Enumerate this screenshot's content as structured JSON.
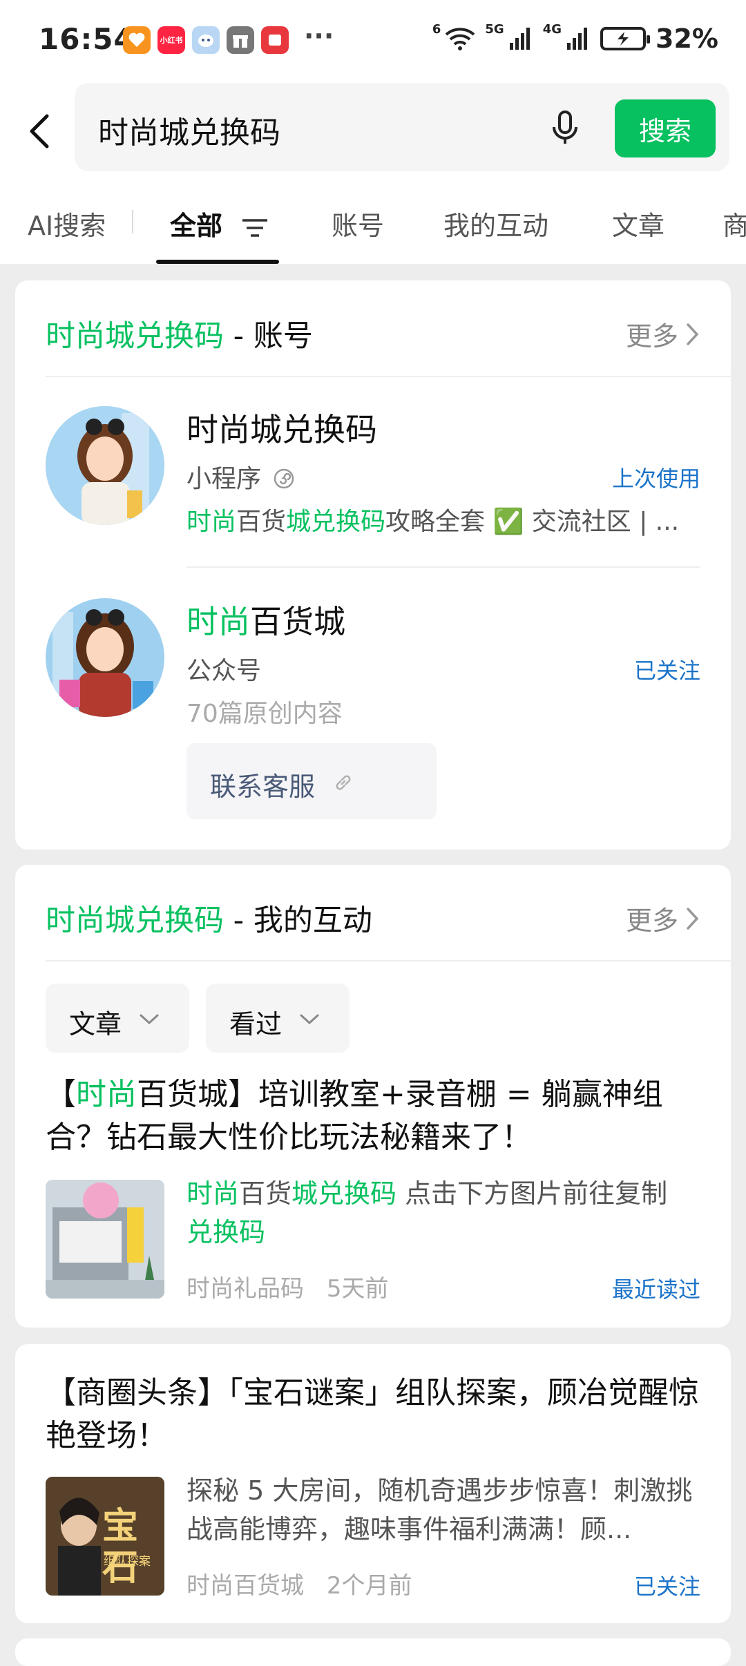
{
  "status_bar": {
    "time": "16:54",
    "battery": "32%",
    "network_5g": "5G",
    "network_4g": "4G",
    "wifi_badge": "6",
    "more_dots": "···",
    "app_xiaohongshu": "小红书"
  },
  "search": {
    "query": "时尚城兑换码",
    "button": "搜索"
  },
  "tabs": [
    {
      "label": "AI搜索"
    },
    {
      "label": "全部"
    },
    {
      "label": "账号"
    },
    {
      "label": "我的互动"
    },
    {
      "label": "文章"
    },
    {
      "label": "商"
    }
  ],
  "accounts_section": {
    "title_keyword": "时尚城兑换码",
    "title_suffix": " - 账号",
    "more": "更多",
    "items": [
      {
        "name": "时尚城兑换码",
        "type": "小程序",
        "desc_parts": [
          "时尚",
          "百货",
          "城兑换码",
          "攻略全套 ✅ 交流社区 | ..."
        ],
        "action": "上次使用"
      },
      {
        "name_highlight": "时尚",
        "name_rest": "百货城",
        "type": "公众号",
        "desc": "70篇原创内容",
        "action": "已关注",
        "contact_button": "联系客服"
      }
    ]
  },
  "interactions_section": {
    "title_keyword": "时尚城兑换码",
    "title_suffix": " - 我的互动",
    "more": "更多",
    "filters": [
      {
        "label": "文章"
      },
      {
        "label": "看过"
      }
    ],
    "article": {
      "title_parts": [
        "【",
        "时尚",
        "百货城】培训教室+录音棚 = 躺赢神组合？钻石最大性价比玩法秘籍来了！"
      ],
      "desc_parts": [
        "时尚",
        "百货",
        "城兑换码",
        " 点击下方图片前往复制",
        "兑换码"
      ],
      "source": "时尚礼品码",
      "time": "5天前",
      "status": "最近读过"
    }
  },
  "article2": {
    "title": "【商圈头条】「宝石谜案」组队探案，顾冶觉醒惊艳登场！",
    "desc": "探秘 5 大房间，随机奇遇步步惊喜！刺激挑战高能博弈，趣味事件福利满满！顾...",
    "source": "时尚百货城",
    "time": "2个月前",
    "status": "已关注",
    "thumb_text": "宝石",
    "thumb_subtext": "组队探案"
  },
  "colors": {
    "accent_green": "#07c160",
    "link_blue": "#1a73c9"
  }
}
